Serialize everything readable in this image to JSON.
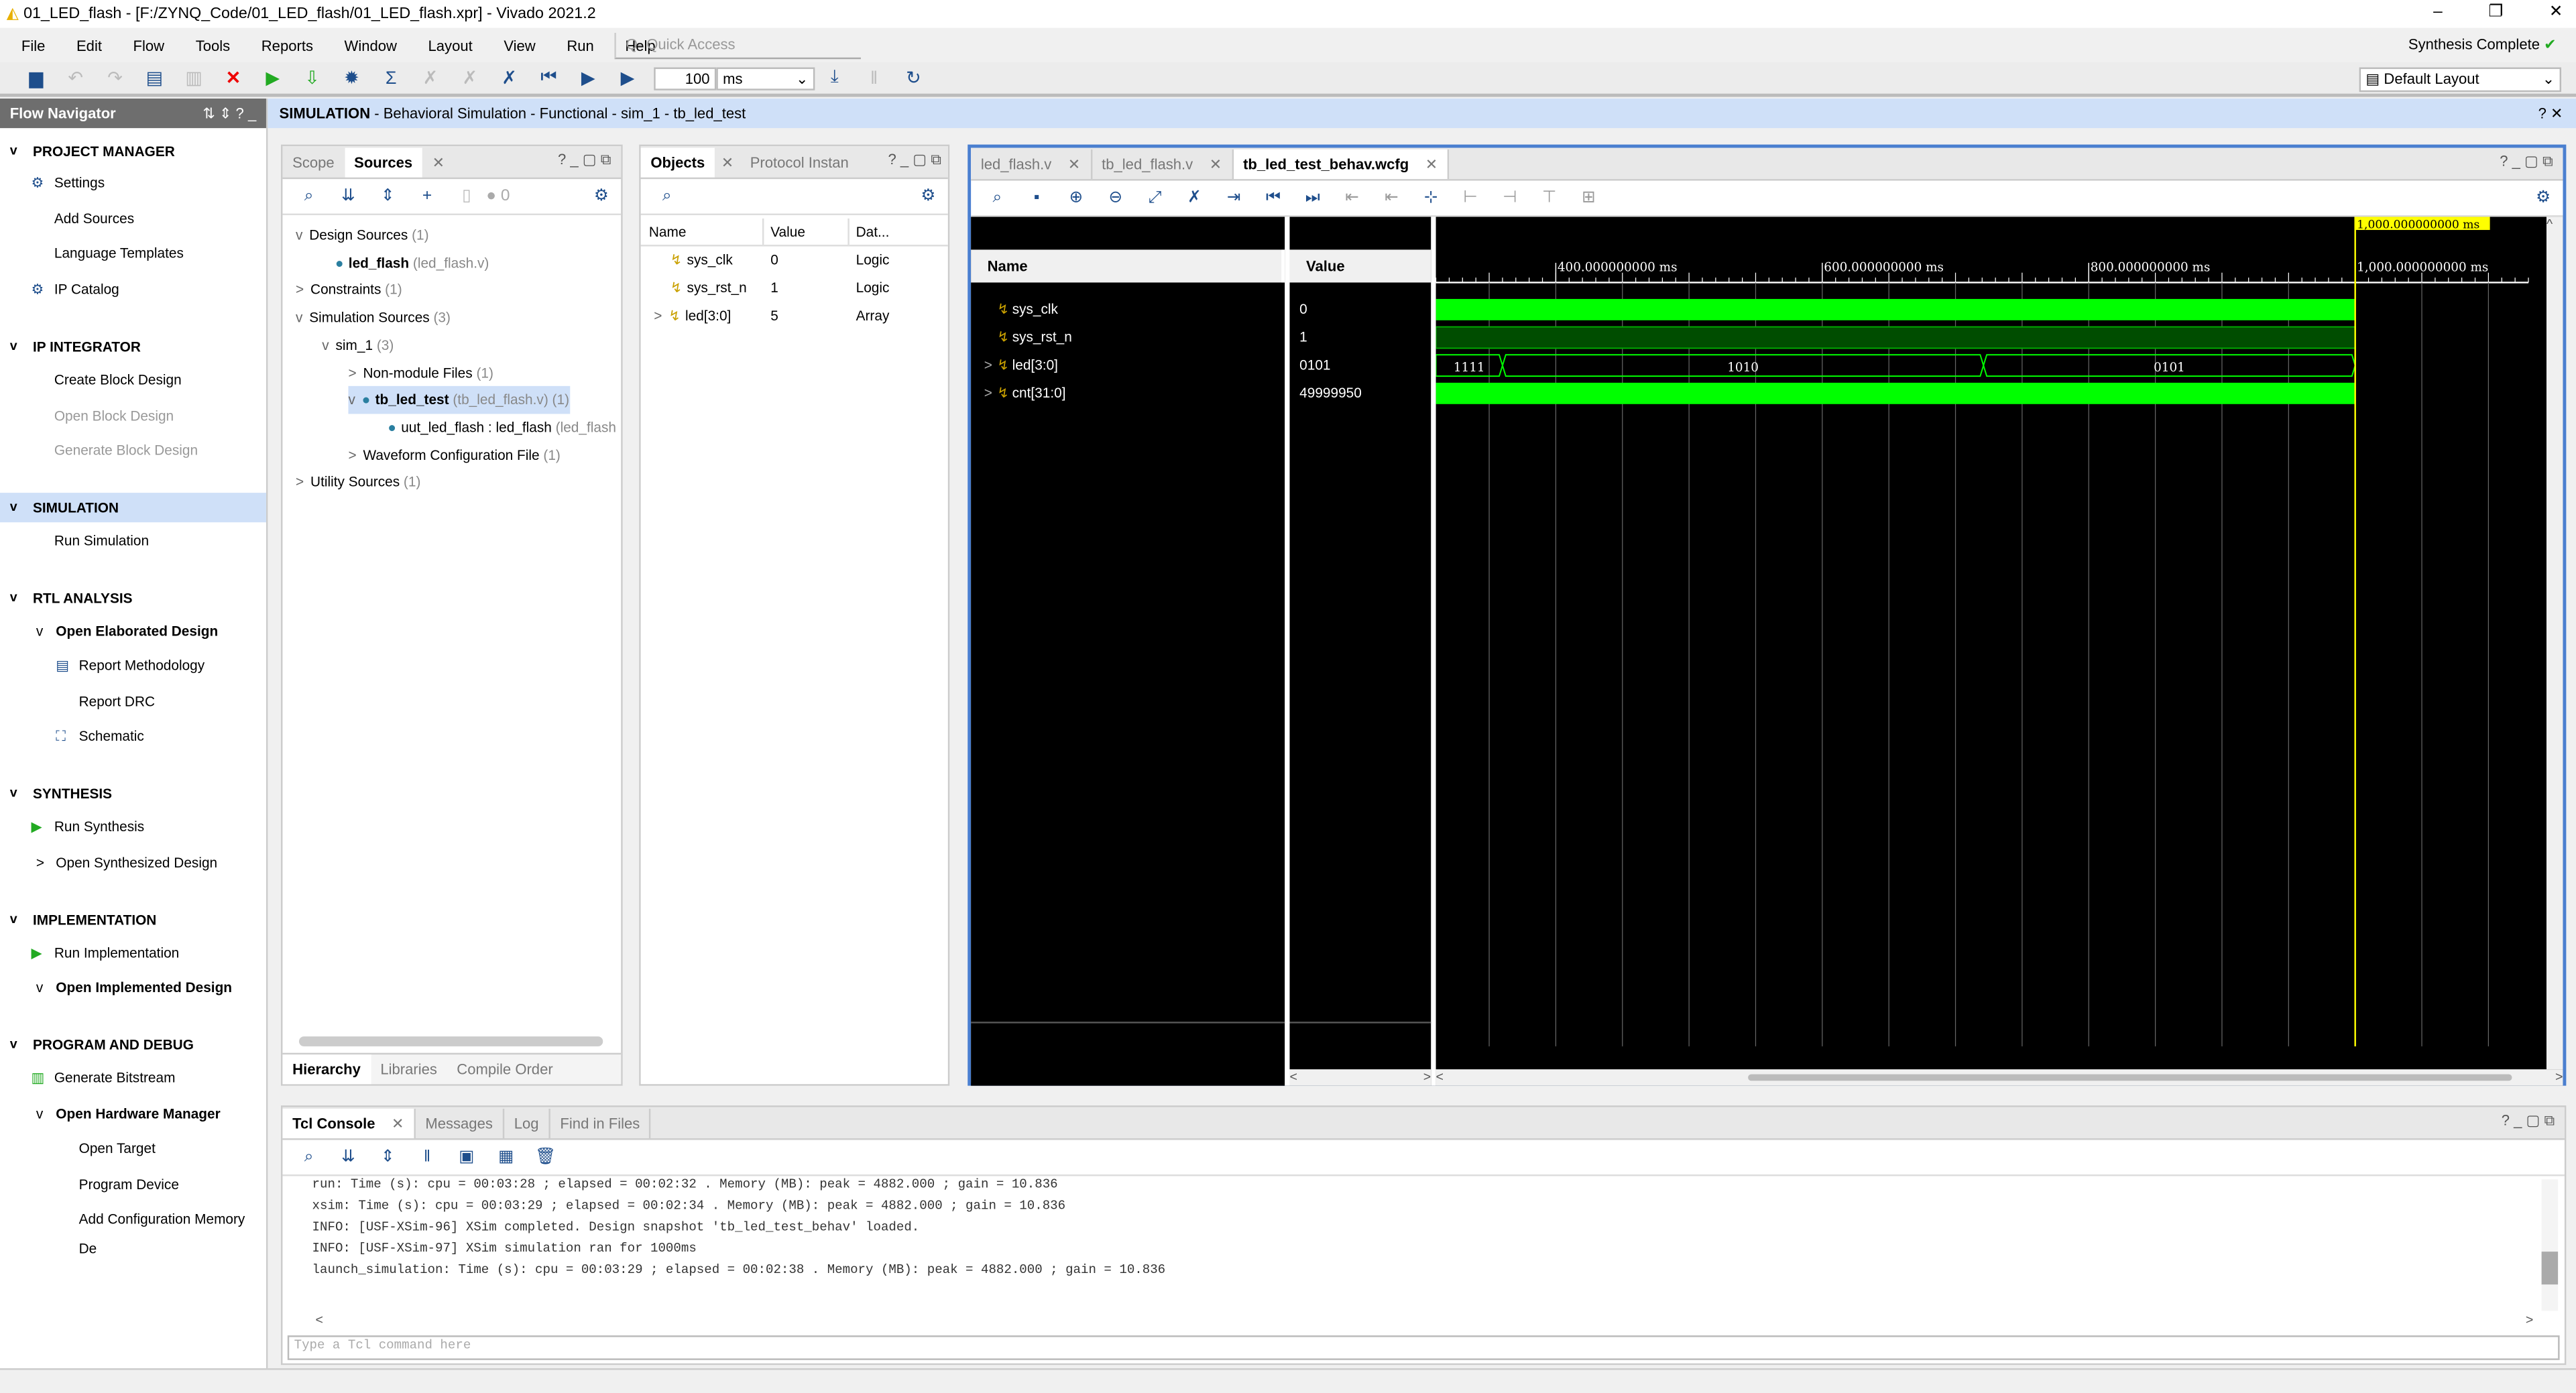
{
  "window": {
    "title": "01_LED_flash - [F:/ZYNQ_Code/01_LED_flash/01_LED_flash.xpr] - Vivado 2021.2",
    "status": "Synthesis Complete",
    "layout": "Default Layout"
  },
  "menu": [
    "File",
    "Edit",
    "Flow",
    "Tools",
    "Reports",
    "Window",
    "Layout",
    "View",
    "Run",
    "Help"
  ],
  "quick_access": {
    "placeholder": "Q- Quick Access"
  },
  "toolbar": {
    "run_time": "100",
    "run_unit": "ms"
  },
  "flow_nav": {
    "title": "Flow Navigator",
    "items": [
      {
        "label": "PROJECT MANAGER",
        "kind": "section"
      },
      {
        "label": "Settings",
        "kind": "item",
        "icon": "gear-icon"
      },
      {
        "label": "Add Sources",
        "kind": "item"
      },
      {
        "label": "Language Templates",
        "kind": "item"
      },
      {
        "label": "IP Catalog",
        "kind": "item",
        "icon": "ip-icon"
      },
      {
        "label": "IP INTEGRATOR",
        "kind": "section"
      },
      {
        "label": "Create Block Design",
        "kind": "item"
      },
      {
        "label": "Open Block Design",
        "kind": "disabled"
      },
      {
        "label": "Generate Block Design",
        "kind": "disabled"
      },
      {
        "label": "SIMULATION",
        "kind": "section",
        "selected": true
      },
      {
        "label": "Run Simulation",
        "kind": "item"
      },
      {
        "label": "RTL ANALYSIS",
        "kind": "section"
      },
      {
        "label": "Open Elaborated Design",
        "kind": "sub"
      },
      {
        "label": "Report Methodology",
        "kind": "item2",
        "icon": "report-icon"
      },
      {
        "label": "Report DRC",
        "kind": "item2"
      },
      {
        "label": "Schematic",
        "kind": "item2",
        "icon": "schematic-icon"
      },
      {
        "label": "SYNTHESIS",
        "kind": "section"
      },
      {
        "label": "Run Synthesis",
        "kind": "item",
        "icon": "play-icon"
      },
      {
        "label": "Open Synthesized Design",
        "kind": "subn"
      },
      {
        "label": "IMPLEMENTATION",
        "kind": "section"
      },
      {
        "label": "Run Implementation",
        "kind": "item",
        "icon": "play-icon"
      },
      {
        "label": "Open Implemented Design",
        "kind": "sub"
      },
      {
        "label": "PROGRAM AND DEBUG",
        "kind": "section"
      },
      {
        "label": "Generate Bitstream",
        "kind": "item",
        "icon": "bitstream-icon"
      },
      {
        "label": "Open Hardware Manager",
        "kind": "sub"
      },
      {
        "label": "Open Target",
        "kind": "item2"
      },
      {
        "label": "Program Device",
        "kind": "item2"
      },
      {
        "label": "Add Configuration Memory De",
        "kind": "item2"
      }
    ]
  },
  "sim_header": {
    "bold": "SIMULATION",
    "rest": " - Behavioral Simulation - Functional - sim_1 - tb_led_test"
  },
  "sources": {
    "tabs": [
      "Scope",
      "Sources"
    ],
    "bottom_tabs": [
      "Hierarchy",
      "Libraries",
      "Compile Order"
    ],
    "count": "0",
    "tree": [
      {
        "label": "Design Sources",
        "extra": " (1)",
        "level": 0,
        "exp": "v"
      },
      {
        "label": "led_flash",
        "extra": " (led_flash.v)",
        "level": 1,
        "bold": true,
        "dot": true
      },
      {
        "label": "Constraints",
        "extra": " (1)",
        "level": 0,
        "exp": ">"
      },
      {
        "label": "Simulation Sources",
        "extra": " (3)",
        "level": 0,
        "exp": "v"
      },
      {
        "label": "sim_1",
        "extra": " (3)",
        "level": 1,
        "exp": "v"
      },
      {
        "label": "Non-module Files",
        "extra": " (1)",
        "level": 2,
        "exp": ">"
      },
      {
        "label": "tb_led_test",
        "extra": " (tb_led_flash.v) (1)",
        "level": 2,
        "exp": "v",
        "bold": true,
        "dot": true,
        "sel": true
      },
      {
        "label": "uut_led_flash : led_flash",
        "extra": " (led_flash",
        "level": 3,
        "dot": true
      },
      {
        "label": "Waveform Configuration File",
        "extra": " (1)",
        "level": 2,
        "exp": ">"
      },
      {
        "label": "Utility Sources",
        "extra": " (1)",
        "level": 0,
        "exp": ">"
      }
    ]
  },
  "objects": {
    "tabs": [
      "Objects",
      "Protocol Instan"
    ],
    "headers": [
      "Name",
      "Value",
      "Dat..."
    ],
    "rows": [
      {
        "name": "sys_clk",
        "value": "0",
        "type": "Logic"
      },
      {
        "name": "sys_rst_n",
        "value": "1",
        "type": "Logic"
      },
      {
        "name": "led[3:0]",
        "value": "5",
        "type": "Array"
      }
    ]
  },
  "wave": {
    "tabs": [
      "led_flash.v",
      "tb_led_flash.v",
      "tb_led_test_behav.wcfg"
    ],
    "headers": [
      "Name",
      "Value"
    ],
    "time_unit": "ms",
    "view_range_ms": [
      310,
      1130
    ],
    "cursor_ms": 1000,
    "cursor_label": "1,000.000000000 ms",
    "ticks": [
      {
        "t": 400,
        "label": "400.000000000 ms"
      },
      {
        "t": 600,
        "label": "600.000000000 ms"
      },
      {
        "t": 800,
        "label": "800.000000000 ms"
      },
      {
        "t": 1000,
        "label": "1,000.000000000 ms"
      }
    ],
    "signals": [
      {
        "name": "sys_clk",
        "value": "0",
        "kind": "clock"
      },
      {
        "name": "sys_rst_n",
        "value": "1",
        "kind": "high"
      },
      {
        "name": "led[3:0]",
        "value": "0101",
        "kind": "bus",
        "segments": [
          {
            "start": 310,
            "end": 360,
            "label": "1111"
          },
          {
            "start": 360,
            "end": 721,
            "label": "1010"
          },
          {
            "start": 721,
            "end": 1000,
            "label": "0101"
          }
        ]
      },
      {
        "name": "cnt[31:0]",
        "value": "49999950",
        "kind": "dense"
      }
    ],
    "colors": {
      "signal": "#00ff00",
      "cursor": "#ffff00",
      "background": "#000000"
    }
  },
  "console": {
    "tabs": [
      "Tcl Console",
      "Messages",
      "Log",
      "Find in Files"
    ],
    "placeholder": "Type a Tcl command here",
    "lines": [
      "run: Time (s): cpu = 00:03:28 ; elapsed = 00:02:32 . Memory (MB): peak = 4882.000 ; gain = 10.836",
      "xsim: Time (s): cpu = 00:03:29 ; elapsed = 00:02:34 . Memory (MB): peak = 4882.000 ; gain = 10.836",
      "INFO: [USF-XSim-96] XSim completed. Design snapshot 'tb_led_test_behav' loaded.",
      "INFO: [USF-XSim-97] XSim simulation ran for 1000ms",
      "launch_simulation: Time (s): cpu = 00:03:29 ; elapsed = 00:02:38 . Memory (MB): peak = 4882.000 ; gain = 10.836"
    ]
  }
}
